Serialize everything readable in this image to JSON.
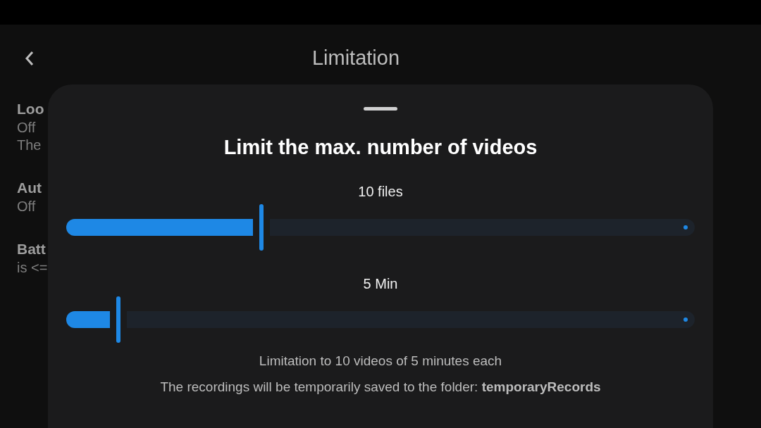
{
  "header": {
    "title": "Limitation"
  },
  "background_list": [
    {
      "title": "Loo",
      "lines": [
        "Off",
        "The"
      ]
    },
    {
      "title": "Aut",
      "lines": [
        "Off"
      ]
    },
    {
      "title": "Batt",
      "lines": [
        "is <="
      ]
    }
  ],
  "sheet": {
    "title": "Limit the max. number of videos",
    "sliders": [
      {
        "reading": "10 files",
        "level": 0.31
      },
      {
        "reading": "5 Min",
        "level": 0.083
      }
    ],
    "summary": "Limitation to 10 videos of 5 minutes each",
    "folder_note": "The recordings will be temporarily saved to the folder: **temporaryRecords**"
  }
}
